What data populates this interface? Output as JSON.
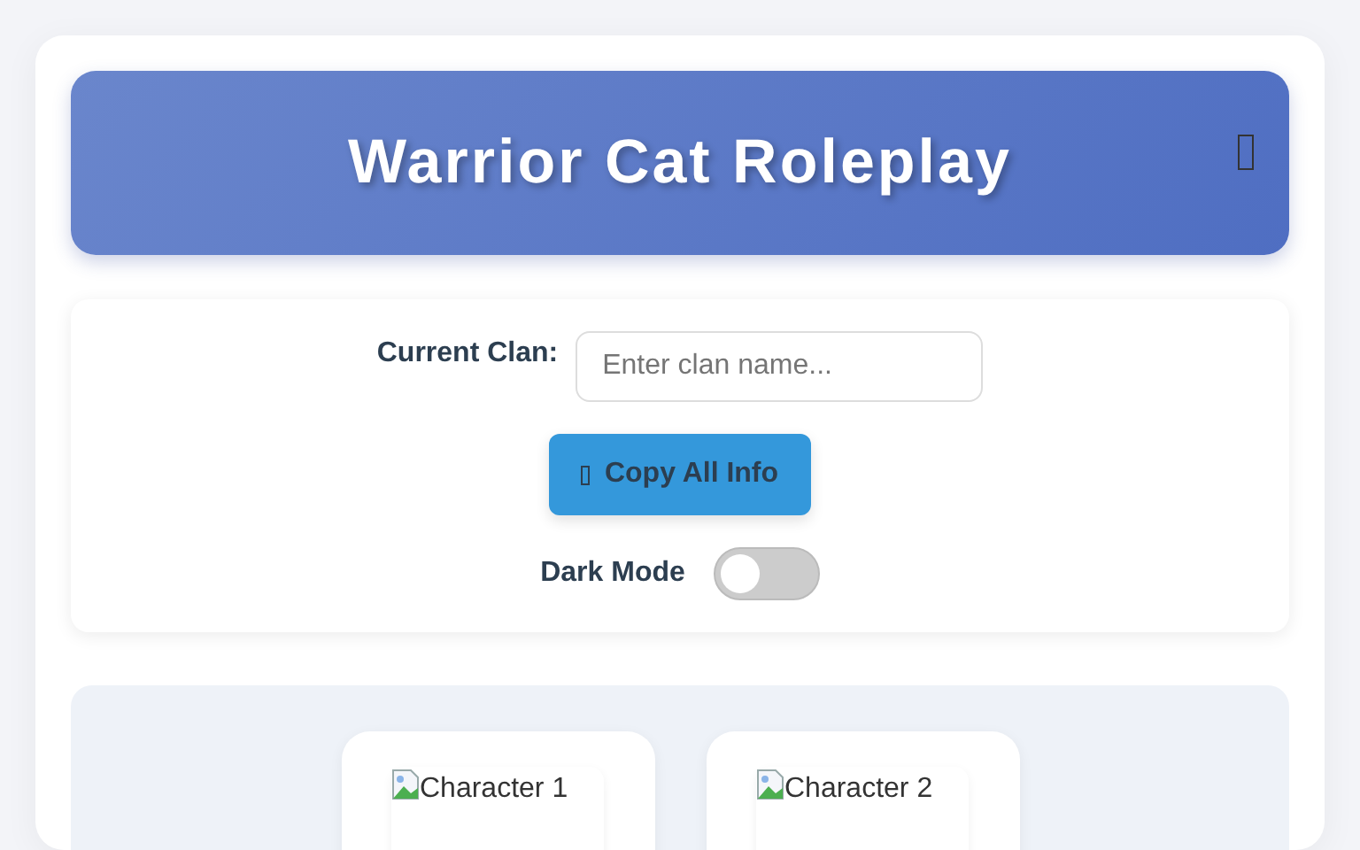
{
  "header": {
    "title": "Warrior Cat Roleplay"
  },
  "controls": {
    "clan_label": "Current Clan:",
    "clan_placeholder": "Enter clan name...",
    "copy_button": "Copy All Info",
    "dark_mode": {
      "label": "Dark Mode",
      "on": false
    }
  },
  "characters": [
    {
      "alt": "Character 1"
    },
    {
      "alt": "Character 2"
    }
  ]
}
